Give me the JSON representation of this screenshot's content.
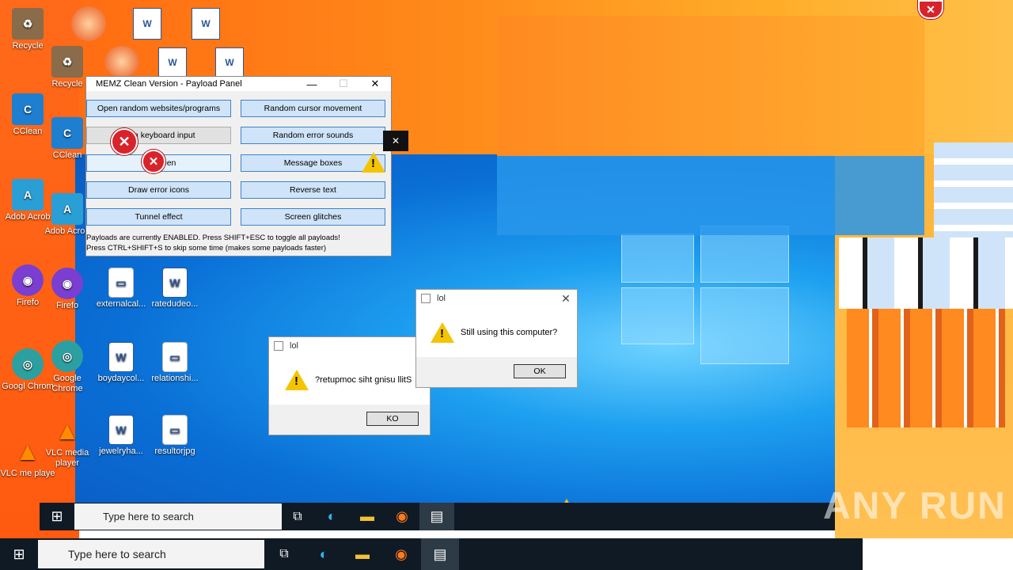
{
  "desktop": {
    "icons_col1": [
      {
        "label": "Recycle",
        "icon": "recycle-bin-icon"
      },
      {
        "label": "CClean",
        "icon": "ccleaner-icon"
      },
      {
        "label": "Adob Acrob",
        "icon": "adobe-acrobat-icon"
      },
      {
        "label": "Firefo",
        "icon": "firefox-icon"
      },
      {
        "label": "Googl Chrom",
        "icon": "chrome-icon"
      },
      {
        "label": "VLC me playe",
        "icon": "vlc-icon"
      }
    ],
    "icons_col2": [
      {
        "label": "Recycle",
        "icon": "recycle-bin-icon"
      },
      {
        "label": "CClean",
        "icon": "ccleaner-icon"
      },
      {
        "label": "Adob Acrob",
        "icon": "adobe-acrobat-icon"
      },
      {
        "label": "Firefo",
        "icon": "firefox-icon"
      },
      {
        "label": "Google Chrome",
        "icon": "chrome-icon"
      },
      {
        "label": "VLC media player",
        "icon": "vlc-icon"
      }
    ],
    "files": [
      {
        "label": "externalcal...",
        "icon": "image-file-icon"
      },
      {
        "label": "ratedudeo...",
        "icon": "word-doc-icon"
      },
      {
        "label": "boydaycol...",
        "icon": "word-doc-icon"
      },
      {
        "label": "relationshi...",
        "icon": "image-file-icon"
      },
      {
        "label": "jewelryha...",
        "icon": "word-doc-icon"
      },
      {
        "label": "resultorjpg",
        "icon": "image-file-icon"
      }
    ]
  },
  "panel": {
    "title": "MEMZ Clean Version - Payload Panel",
    "buttons": [
      "Open random websites/programs",
      "Random cursor movement",
      "dom keyboard input",
      "Random error sounds",
      "Fla          creen",
      "Message boxes",
      "Draw error icons",
      "Reverse text",
      "Tunnel effect",
      "Screen glitches"
    ],
    "note_line1": "Payloads are currently ENABLED. Press SHIFT+ESC to toggle all payloads!",
    "note_line2": "Press CTRL+SHIFT+S to skip some time (makes some payloads faster)"
  },
  "dialogs": [
    {
      "title": "lol",
      "message": "Still using this computer?",
      "button": "OK"
    },
    {
      "title": "lol",
      "message": "?retupmoc siht gnisu llitS",
      "button": "KO"
    }
  ],
  "taskbar": {
    "search_placeholder": "Type here to search"
  },
  "watermark": "ANY RUN",
  "colors": {
    "accent_orange": "#ff6a1a",
    "desktop_blue": "#0a6fd6",
    "taskbar": "#0f1a24",
    "error_red": "#d9232b",
    "warning_yellow": "#f5c400"
  }
}
